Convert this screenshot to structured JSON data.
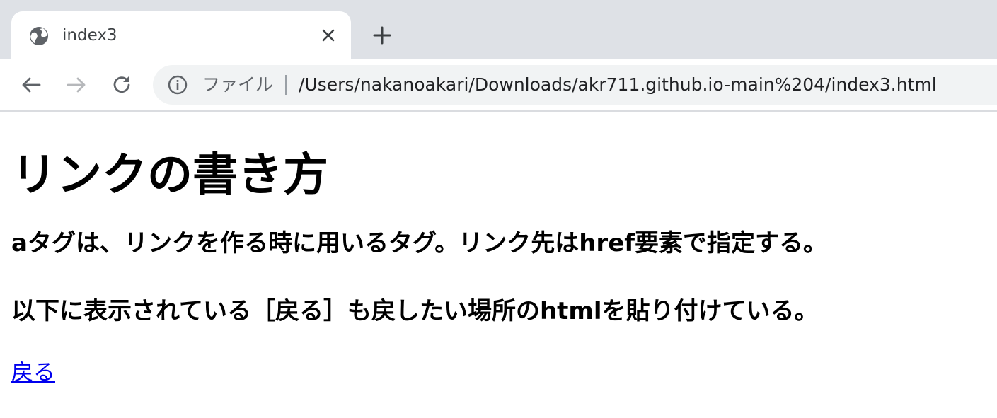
{
  "browser": {
    "tab": {
      "title": "index3",
      "favicon": "globe-icon",
      "close_icon": "close-icon"
    },
    "new_tab_icon": "plus-icon",
    "toolbar": {
      "back_icon": "arrow-left-icon",
      "forward_icon": "arrow-right-icon",
      "reload_icon": "reload-icon"
    },
    "omnibox": {
      "info_icon": "info-icon",
      "scheme_label": "ファイル",
      "url": "/Users/nakanoakari/Downloads/akr711.github.io-main%204/index3.html"
    }
  },
  "page": {
    "title": "リンクの書き方",
    "paragraphs": [
      "aタグは、リンクを作る時に用いるタグ。リンク先はhref要素で指定する。",
      "以下に表示されている［戻る］も戻したい場所のhtmlを貼り付けている。"
    ],
    "back_link": "戻る",
    "link_color": "#0000ee"
  },
  "colors": {
    "tabstrip": "#dee1e6",
    "omnibox": "#f1f3f4",
    "icon": "#5f6368",
    "icon_disabled": "#b6b8bb"
  }
}
